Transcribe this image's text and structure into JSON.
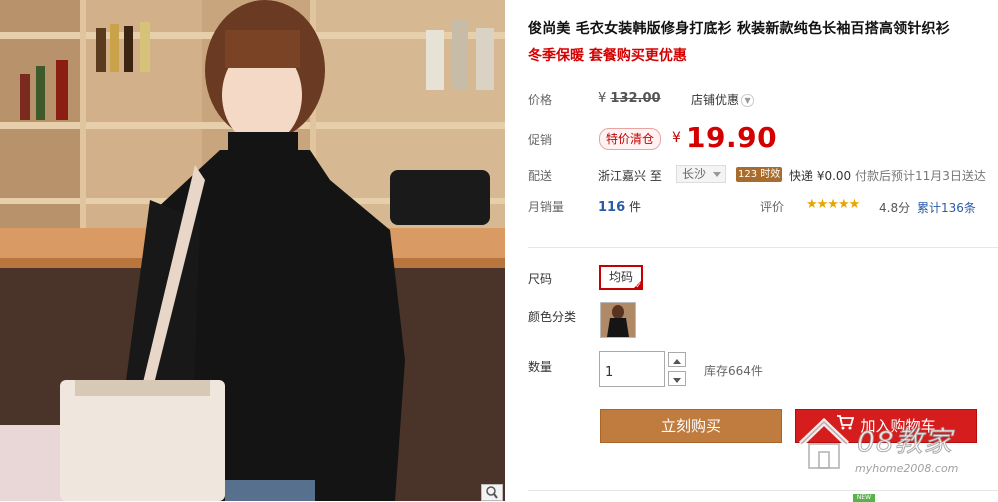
{
  "product": {
    "title": "俊尚美 毛衣女装韩版修身打底衫 秋装新款纯色长袖百搭高领针织衫",
    "subtitle": "冬季保暖 套餐购买更优惠"
  },
  "price": {
    "label": "价格",
    "yen": "¥",
    "original": "132.00",
    "shop_discount": "店铺优惠"
  },
  "promo": {
    "label": "促销",
    "tag": "特价清仓",
    "yen": "¥",
    "price": "19.90"
  },
  "shipping": {
    "label": "配送",
    "from": "浙江嘉兴 至",
    "to": "长沙",
    "badge": "123 时效",
    "fee": "快递 ¥0.00",
    "note": "付款后预计11月3日送达"
  },
  "sales": {
    "label": "月销量",
    "count": "116",
    "unit": "件",
    "rating_label": "评价",
    "stars": "★★★★★",
    "score": "4.8分",
    "reviews": "累计136条"
  },
  "options": {
    "size_label": "尺码",
    "size_value": "均码",
    "color_label": "颜色分类",
    "qty_label": "数量",
    "qty_value": "1",
    "stock": "库存664件"
  },
  "actions": {
    "buy": "立刻购买",
    "cart": "加入购物车"
  },
  "watermark": {
    "text": "08教家",
    "url": "myhome2008.com",
    "badge": "NEW"
  },
  "colors": {
    "accent_red": "#d40000",
    "buy_button": "#c07b3f",
    "cart_button": "#d51d1d",
    "link_blue": "#2b5aa8"
  }
}
